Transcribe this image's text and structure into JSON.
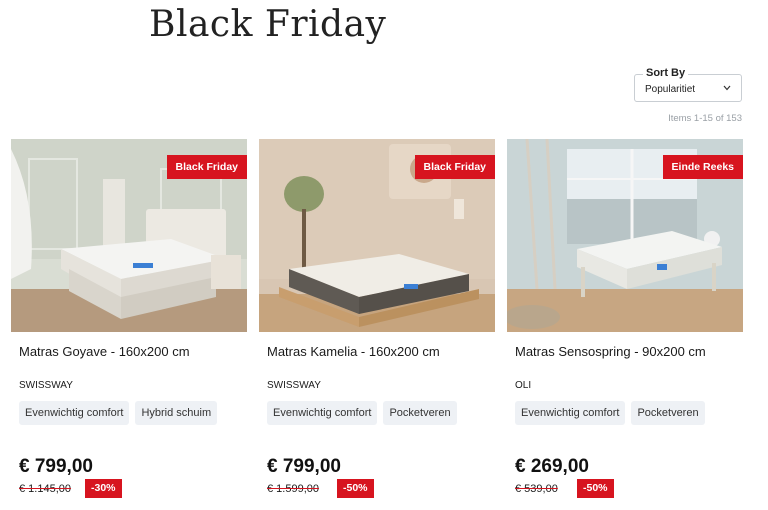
{
  "page": {
    "title": "Black Friday"
  },
  "sort": {
    "label": "Sort By",
    "value": "Popularitiet"
  },
  "items_count": "Items 1-15 of 153",
  "products": [
    {
      "name": "Matras Goyave - 160x200 cm",
      "brand": "SWISSWAY",
      "badge": "Black Friday",
      "tags": [
        "Evenwichtig comfort",
        "Hybrid schuim"
      ],
      "price": "€ 799,00",
      "old_price": "€ 1.145,00",
      "discount": "-30%"
    },
    {
      "name": "Matras Kamelia - 160x200 cm",
      "brand": "SWISSWAY",
      "badge": "Black Friday",
      "tags": [
        "Evenwichtig comfort",
        "Pocketveren"
      ],
      "price": "€ 799,00",
      "old_price": "€ 1.599,00",
      "discount": "-50%"
    },
    {
      "name": "Matras Sensospring - 90x200 cm",
      "brand": "OLI",
      "badge": "Einde Reeks",
      "tags": [
        "Evenwichtig comfort",
        "Pocketveren"
      ],
      "price": "€ 269,00",
      "old_price": "€ 539,00",
      "discount": "-50%"
    }
  ],
  "colors": {
    "badge_red": "#d7141f",
    "tag_bg": "#eef1f5"
  },
  "icons": {
    "sort_toggle": "chevron-down-icon"
  }
}
